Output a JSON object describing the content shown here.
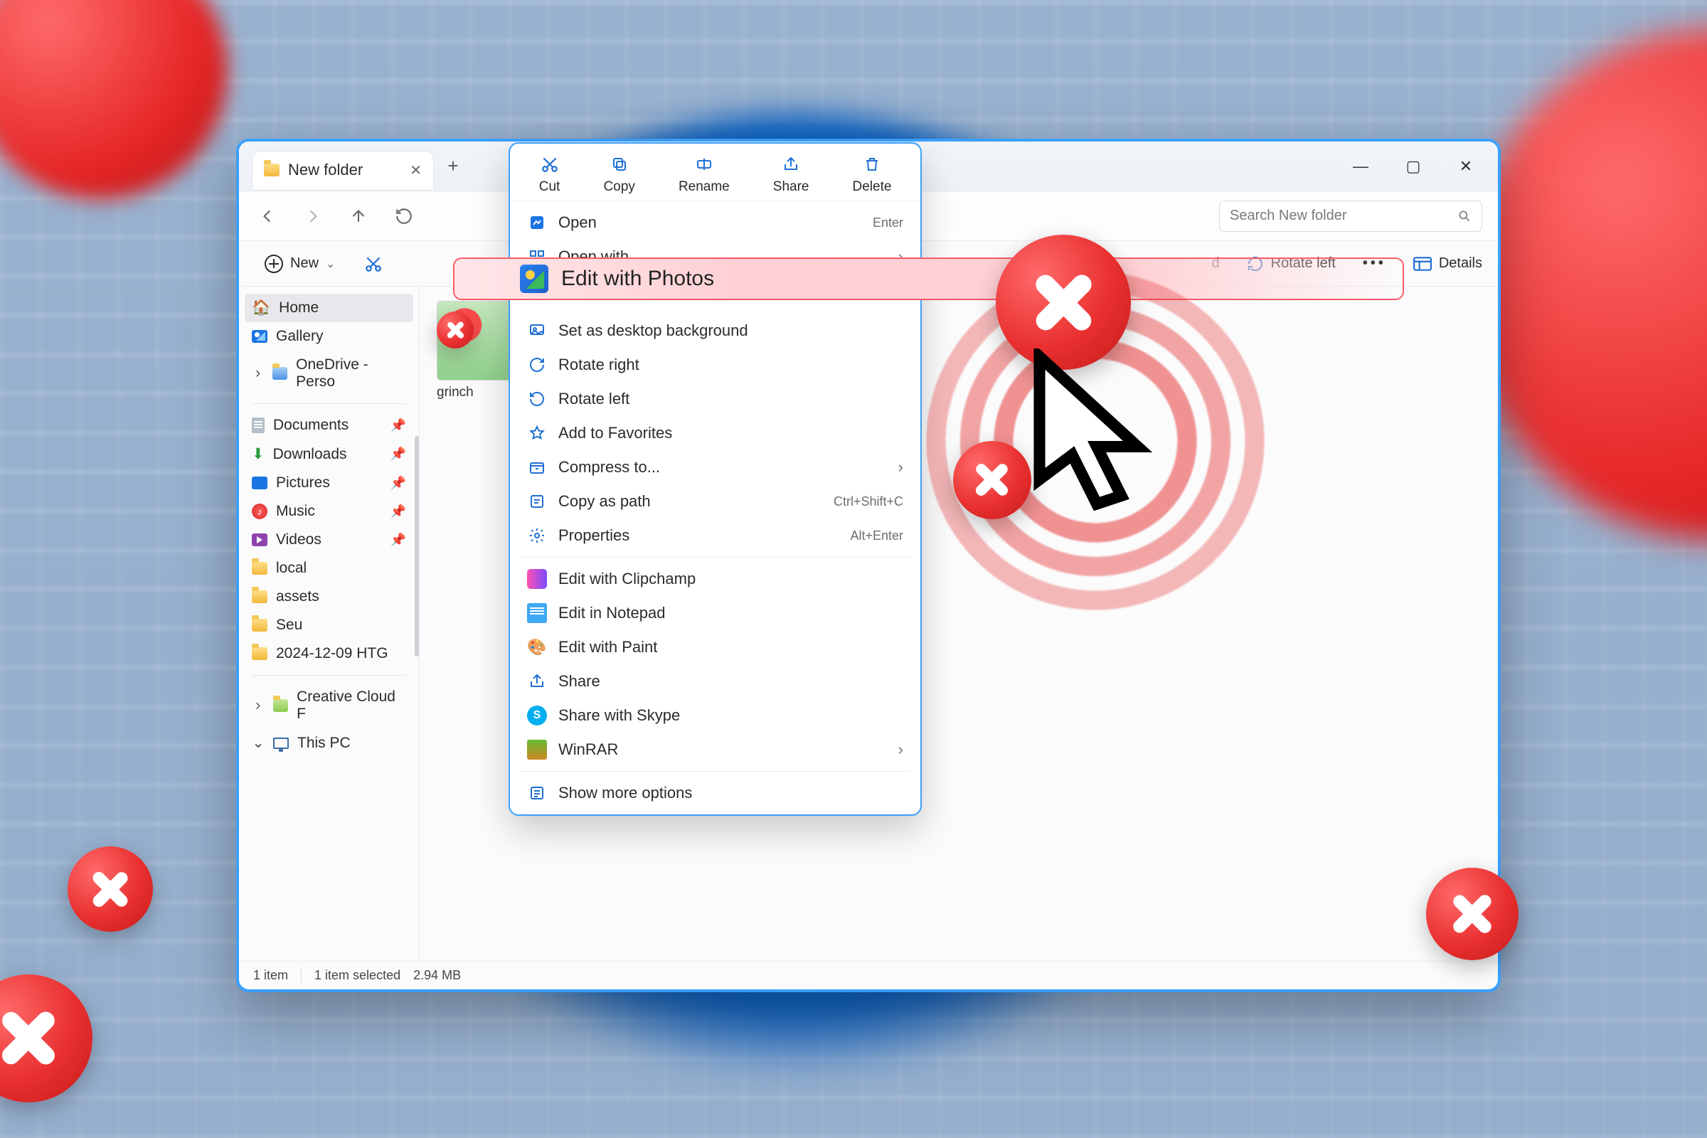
{
  "window": {
    "tab_title": "New folder",
    "plus": "+"
  },
  "nav": {
    "search_placeholder": "Search New folder"
  },
  "toolbar": {
    "new_label": "New",
    "rotate_left": "Rotate left",
    "details": "Details",
    "right_truncated": "d"
  },
  "sidebar": {
    "home": "Home",
    "gallery": "Gallery",
    "onedrive": "OneDrive - Perso",
    "documents": "Documents",
    "downloads": "Downloads",
    "pictures": "Pictures",
    "music": "Music",
    "videos": "Videos",
    "local": "local",
    "assets": "assets",
    "seu": "Seu",
    "dated": "2024-12-09 HTG",
    "creative": "Creative Cloud F",
    "this_pc": "This PC"
  },
  "content": {
    "thumb_label": "grinch"
  },
  "status": {
    "count": "1 item",
    "selected": "1 item selected",
    "size": "2.94 MB"
  },
  "context": {
    "top": {
      "cut": "Cut",
      "copy": "Copy",
      "rename": "Rename",
      "share": "Share",
      "delete": "Delete"
    },
    "open": "Open",
    "open_shortcut": "Enter",
    "open_with": "Open with",
    "edit_photos": "Edit with Photos",
    "set_bg": "Set as desktop background",
    "rotate_right": "Rotate right",
    "rotate_left": "Rotate left",
    "favorites": "Add to Favorites",
    "compress": "Compress to...",
    "copy_path": "Copy as path",
    "copy_path_shortcut": "Ctrl+Shift+C",
    "properties": "Properties",
    "properties_shortcut": "Alt+Enter",
    "clipchamp": "Edit with Clipchamp",
    "notepad": "Edit in Notepad",
    "paint": "Edit with Paint",
    "share2": "Share",
    "skype": "Share with Skype",
    "winrar": "WinRAR",
    "more": "Show more options"
  }
}
